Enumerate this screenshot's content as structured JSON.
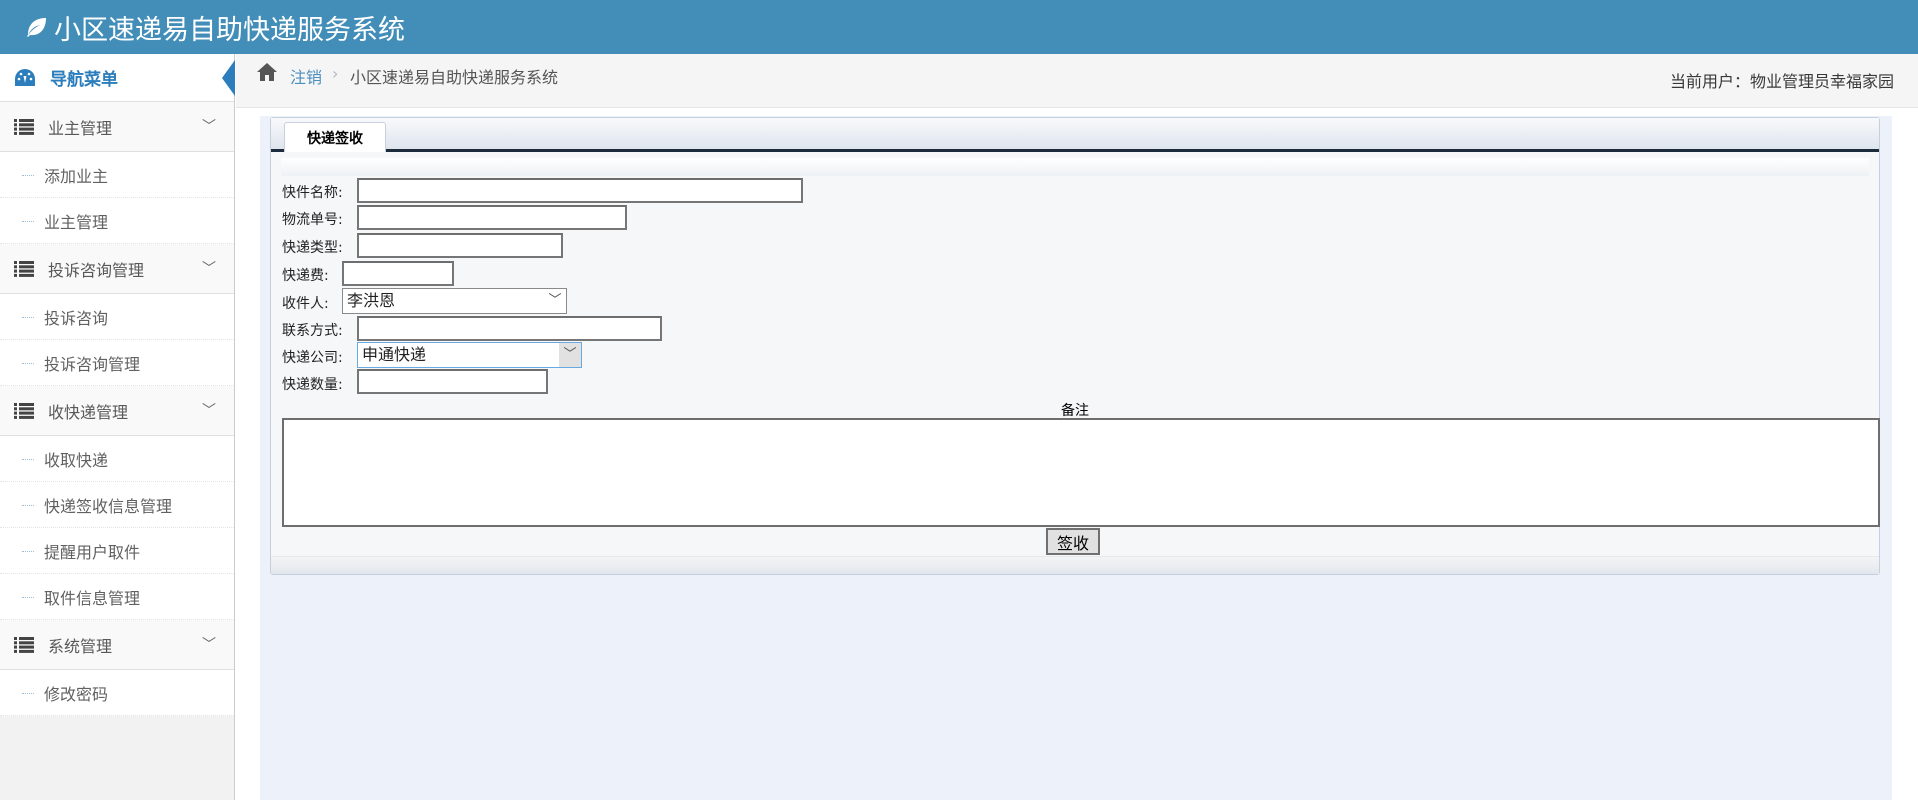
{
  "header": {
    "title": "小区速递易自助快递服务系统",
    "logo_icon": "leaf-icon"
  },
  "sidebar": {
    "nav_title": "导航菜单",
    "groups": [
      {
        "label": "业主管理",
        "items": [
          "添加业主",
          "业主管理"
        ]
      },
      {
        "label": "投诉咨询管理",
        "items": [
          "投诉咨询",
          "投诉咨询管理"
        ]
      },
      {
        "label": "收快递管理",
        "items": [
          "收取快递",
          "快递签收信息管理",
          "提醒用户取件",
          "取件信息管理"
        ]
      },
      {
        "label": "系统管理",
        "items": [
          "修改密码"
        ]
      }
    ]
  },
  "breadcrumb": {
    "logout": "注销",
    "separator": "›",
    "system": "小区速递易自助快递服务系统",
    "current_user": "当前用户：物业管理员幸福家园"
  },
  "panel": {
    "tab": "快递签收"
  },
  "form": {
    "labels": [
      "快件名称:",
      "物流单号:",
      "快递类型:",
      "快递费:",
      "收件人:",
      "联系方式:",
      "快递公司:",
      "快递数量:"
    ],
    "recipient": "李洪恩",
    "company": "申通快递",
    "remark_label": "备注",
    "submit": "签收"
  },
  "colors": {
    "header": "#438eb9",
    "accent": "#2b7dbc",
    "content_bg": "#edf1f9"
  }
}
